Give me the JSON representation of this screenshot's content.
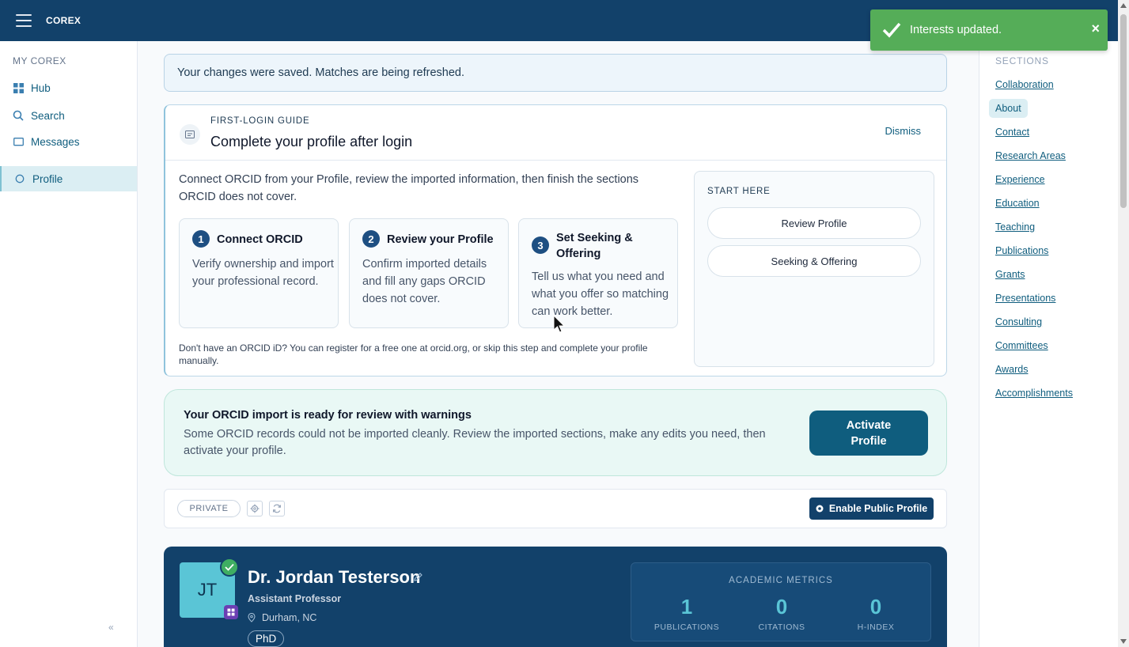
{
  "app": {
    "brand": "COREX"
  },
  "sidebar": {
    "heading": "MY COREX",
    "items": [
      {
        "label": "Hub",
        "icon": "grid-icon"
      },
      {
        "label": "Search",
        "icon": "search-icon"
      },
      {
        "label": "Messages",
        "icon": "message-icon"
      },
      {
        "label": "Profile",
        "icon": "circle-icon",
        "active": true
      }
    ],
    "collapse": "«"
  },
  "banner": {
    "text": "Your changes were saved. Matches are being refreshed."
  },
  "guide": {
    "kicker": "FIRST-LOGIN GUIDE",
    "title": "Complete your profile after login",
    "dismiss": "Dismiss",
    "intro": "Connect ORCID from your Profile, review the imported information, then finish the sections ORCID does not cover.",
    "steps": [
      {
        "num": "1",
        "title": "Connect ORCID",
        "body": "Verify ownership and import your professional record."
      },
      {
        "num": "2",
        "title": "Review your Profile",
        "body": "Confirm imported details and fill any gaps ORCID does not cover."
      },
      {
        "num": "3",
        "title": "Set Seeking & Offering",
        "body": "Tell us what you need and what you offer so matching can work better."
      }
    ],
    "footnote": "Don't have an ORCID iD? You can register for a free one at orcid.org, or skip this step and complete your profile manually.",
    "start_here": {
      "label": "START HERE",
      "buttons": [
        "Review Profile",
        "Seeking & Offering"
      ]
    }
  },
  "import_notice": {
    "title": "Your ORCID import is ready for review with warnings",
    "body": "Some ORCID records could not be imported cleanly. Review the imported sections, make any edits you need, then activate your profile.",
    "button": "Activate Profile"
  },
  "privacy": {
    "status": "PRIVATE",
    "public_button": "Enable Public Profile"
  },
  "profile": {
    "initials": "JT",
    "name": "Dr. Jordan Testerson",
    "title": "Assistant Professor",
    "location": "Durham, NC",
    "degree": "PhD",
    "metrics_label": "ACADEMIC METRICS",
    "metrics": [
      {
        "value": "1",
        "label": "PUBLICATIONS"
      },
      {
        "value": "0",
        "label": "CITATIONS"
      },
      {
        "value": "0",
        "label": "H-INDEX"
      }
    ]
  },
  "sections": {
    "heading": "SECTIONS",
    "items": [
      "Collaboration",
      "About",
      "Contact",
      "Research Areas",
      "Experience",
      "Education",
      "Teaching",
      "Publications",
      "Grants",
      "Presentations",
      "Consulting",
      "Committees",
      "Awards",
      "Accomplishments"
    ],
    "active": "About"
  },
  "toast": {
    "text": "Interests updated.",
    "close": "×"
  },
  "colors": {
    "topbar": "#12416a",
    "accent": "#0f5d7e",
    "toast": "#55ad58",
    "import_bg": "#e9f8f5"
  }
}
